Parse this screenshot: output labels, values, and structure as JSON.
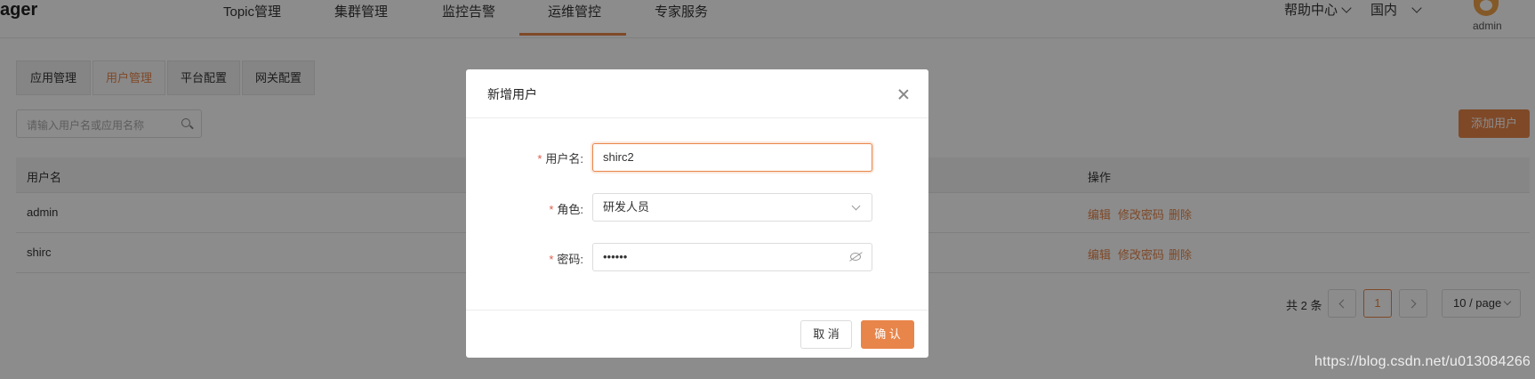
{
  "header": {
    "logo": "ager",
    "nav": [
      {
        "label": "Topic管理"
      },
      {
        "label": "集群管理"
      },
      {
        "label": "监控告警"
      },
      {
        "label": "运维管控",
        "active": true
      },
      {
        "label": "专家服务"
      }
    ],
    "help_label": "帮助中心",
    "region_label": "国内",
    "username": "admin"
  },
  "tabs": [
    {
      "label": "应用管理"
    },
    {
      "label": "用户管理",
      "active": true
    },
    {
      "label": "平台配置"
    },
    {
      "label": "网关配置"
    }
  ],
  "search": {
    "placeholder": "请输入用户名或应用名称"
  },
  "add_user_label": "添加用户",
  "table": {
    "headers": {
      "username": "用户名",
      "actions": "操作"
    },
    "rows": [
      {
        "username": "admin",
        "edit": "编辑",
        "change_pw": "修改密码",
        "delete": "删除"
      },
      {
        "username": "shirc",
        "edit": "编辑",
        "change_pw": "修改密码",
        "delete": "删除"
      }
    ]
  },
  "pagination": {
    "total_text": "共 2 条",
    "current": "1",
    "page_size": "10 / page"
  },
  "modal": {
    "title": "新增用户",
    "fields": {
      "username_label": "用户名:",
      "username_value": "shirc2",
      "role_label": "角色:",
      "role_value": "研发人员",
      "password_label": "密码:",
      "password_value": "••••••"
    },
    "cancel_label": "取 消",
    "confirm_label": "确 认"
  },
  "watermark": "https://blog.csdn.net/u013084266",
  "colors": {
    "accent": "#e8854a",
    "required": "#e05b4a"
  }
}
